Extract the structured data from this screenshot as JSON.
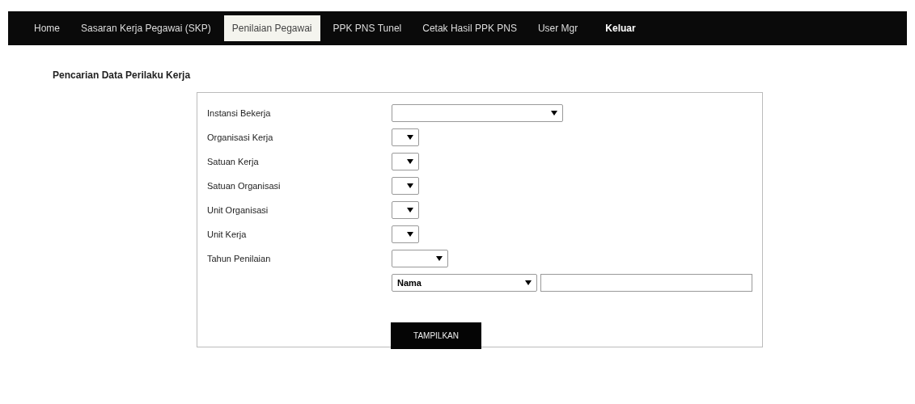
{
  "nav": [
    {
      "label": "Home",
      "selected": false
    },
    {
      "label": "Sasaran Kerja Pegawai (SKP)",
      "selected": false
    },
    {
      "label": "Penilaian Pegawai",
      "selected": true
    },
    {
      "label": "PPK PNS Tunel",
      "selected": false
    },
    {
      "label": "Cetak Hasil PPK PNS",
      "selected": false
    },
    {
      "label": "User Mgr",
      "selected": false
    },
    {
      "label": "Keluar",
      "selected": false
    }
  ],
  "heading": "Pencarian Data Perilaku Kerja",
  "fields": [
    {
      "label": "Instansi Bekerja",
      "kind": "wide"
    },
    {
      "label": "Organisasi Kerja",
      "kind": "narrow"
    },
    {
      "label": "Satuan Kerja",
      "kind": "narrow"
    },
    {
      "label": "Satuan Organisasi",
      "kind": "narrow"
    },
    {
      "label": "Unit Organisasi",
      "kind": "narrow"
    },
    {
      "label": "Unit Kerja",
      "kind": "narrow"
    },
    {
      "label": "Tahun Penilaian",
      "kind": "medium"
    }
  ],
  "search": {
    "by": "Nama"
  },
  "button": "TAMPILKAN"
}
